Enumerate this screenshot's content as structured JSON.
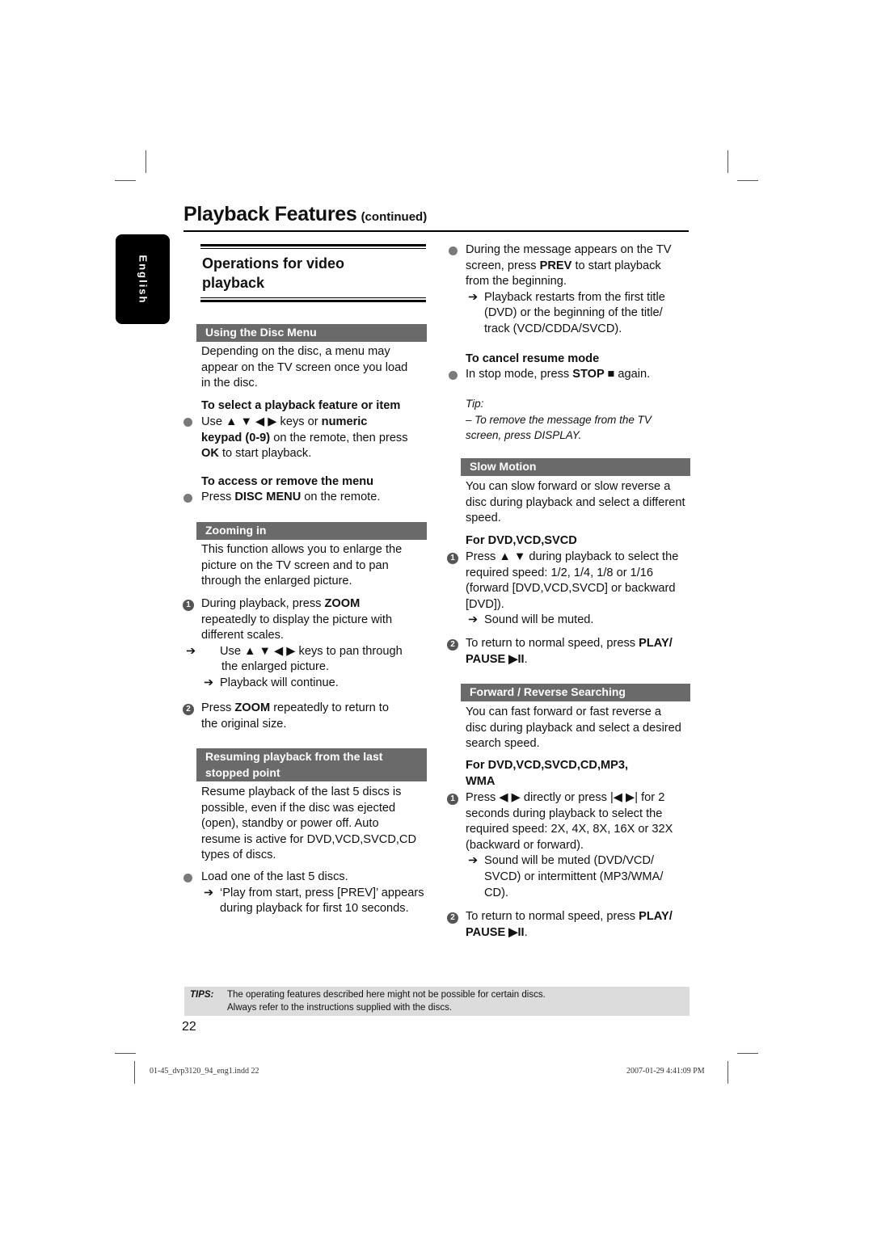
{
  "header": {
    "title": "Playback Features",
    "title_suffix": "(continued)",
    "language_tab": "English"
  },
  "left": {
    "section_title_line1": "Operations for video",
    "section_title_line2": "playback",
    "disc_menu": {
      "heading": "Using the Disc Menu",
      "intro": [
        "Depending on the disc, a menu may",
        "appear on the TV screen once you load",
        "in the disc."
      ],
      "select_heading": "To select a playback feature or item",
      "select_lines": [
        "Use ▲ ▼ ◀ ▶ keys or ",
        "numeric",
        "keypad (0-9)",
        " on the remote, then press",
        "OK",
        " to start playback."
      ],
      "access_heading": "To access or remove the menu",
      "access_pre": "Press ",
      "access_bold": "DISC MENU",
      "access_post": " on the remote."
    },
    "zoom": {
      "heading": "Zooming in",
      "intro": [
        "This function allows you to enlarge the",
        "picture on the TV screen and to pan",
        "through the enlarged picture."
      ],
      "step1_pre": "During playback, press ",
      "step1_bold": "ZOOM",
      "step1_l2": "repeatedly to display the picture with",
      "step1_l3": "different scales.",
      "step1_arrow1_l1": "Use ▲ ▼ ◀ ▶ keys to pan through",
      "step1_arrow1_l2": "the enlarged picture.",
      "step1_arrow2": "Playback will continue.",
      "step2_pre": "Press ",
      "step2_bold": "ZOOM",
      "step2_post": " repeatedly to return to",
      "step2_l2": "the original size."
    },
    "resume": {
      "heading_l1": "Resuming playback from the last",
      "heading_l2": "stopped point",
      "intro": [
        "Resume playback of the last 5 discs is",
        "possible, even if the disc was ejected",
        "(open), standby or power off. Auto",
        "resume is active for DVD,VCD,SVCD,CD",
        "types of discs."
      ],
      "bullet": "Load one of the last 5 discs.",
      "arrow_l1": "‘Play from start, press [PREV]’ appears",
      "arrow_l2": "during playback for first 10 seconds."
    }
  },
  "right": {
    "resume_cont": {
      "bullet_l1": "During the message appears on the TV",
      "bullet_l2_pre": "screen, press ",
      "bullet_l2_bold": "PREV",
      "bullet_l2_post": " to start playback",
      "bullet_l3": "from the beginning.",
      "arrow_l1": "Playback restarts from the first title",
      "arrow_l2": "(DVD) or the beginning of the title/",
      "arrow_l3": "track (VCD/CDDA/SVCD).",
      "cancel_heading": "To cancel resume mode",
      "cancel_pre": "In stop mode, press ",
      "cancel_bold": "STOP ■",
      "cancel_post": " again.",
      "tip_label": "Tip:",
      "tip_l1": "– To remove the message from the TV",
      "tip_l2": "screen, press DISPLAY."
    },
    "slow": {
      "heading": "Slow Motion",
      "intro": [
        "You can slow forward or slow reverse a",
        "disc during playback and select a different",
        "speed."
      ],
      "for_heading": "For DVD,VCD,SVCD",
      "step1_l1": "Press ▲ ▼ during playback to select the",
      "step1_l2": "required speed: 1/2, 1/4, 1/8 or 1/16",
      "step1_l3": "(forward [DVD,VCD,SVCD] or backward",
      "step1_l4": "[DVD]).",
      "step1_arrow": "Sound will be muted.",
      "step2_pre": "To return to normal speed, press ",
      "step2_bold1": "PLAY/",
      "step2_bold2": "PAUSE ▶II",
      "step2_post": "."
    },
    "search": {
      "heading": "Forward / Reverse Searching",
      "intro": [
        "You can fast forward or fast reverse a",
        "disc during playback and select a desired",
        "search speed."
      ],
      "for_heading_l1": "For DVD,VCD,SVCD,CD,MP3,",
      "for_heading_l2": "WMA",
      "step1_l1": "Press ◀ ▶ directly or press |◀  ▶| for 2",
      "step1_l2": "seconds during playback to select the",
      "step1_l3": "required speed: 2X, 4X, 8X, 16X or 32X",
      "step1_l4": "(backward or forward).",
      "step1_arrow_l1": "Sound will be muted (DVD/VCD/",
      "step1_arrow_l2": "SVCD) or intermittent (MP3/WMA/",
      "step1_arrow_l3": "CD).",
      "step2_pre": "To return to normal speed, press ",
      "step2_bold1": "PLAY/",
      "step2_bold2": "PAUSE ▶II",
      "step2_post": "."
    }
  },
  "tips": {
    "label": "TIPS:",
    "line1": "The operating features described here might not be possible for certain discs.",
    "line2": "Always refer to the instructions supplied with the discs."
  },
  "page_number": "22",
  "slug": {
    "file": "01-45_dvp3120_94_eng1.indd   22",
    "datetime": "2007-01-29   4:41:09 PM"
  },
  "symbols": {
    "arrow": "➔",
    "num1": "1",
    "num2": "2"
  }
}
